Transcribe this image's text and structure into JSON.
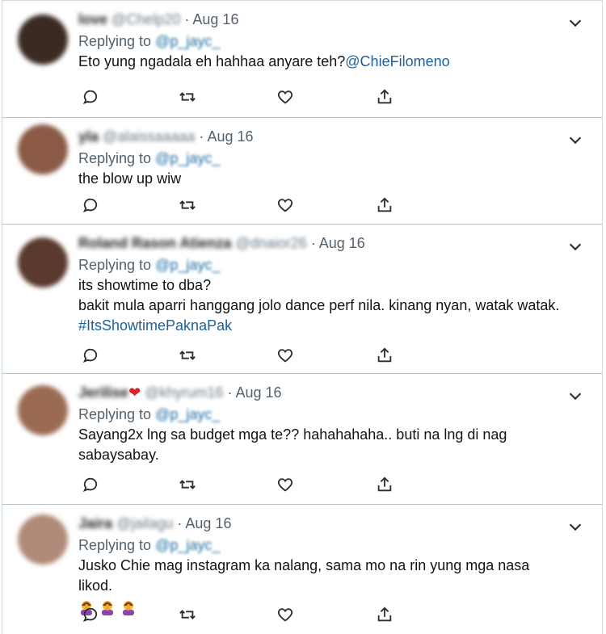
{
  "tweets": [
    {
      "name": "love",
      "handle": "@Chelp20",
      "date": "Aug 16",
      "replying_label": "Replying to",
      "replying_to": "@p_jayc_",
      "lines": [
        "Eto yung ngadala eh hahhaa anyare teh?"
      ],
      "trailing_link": "@ChieFilomeno",
      "avatar_color": "#3b2a22"
    },
    {
      "name": "yla",
      "handle": "@alaissaaaaa",
      "date": "Aug 16",
      "replying_label": "Replying to",
      "replying_to": "@p_jayc_",
      "lines": [
        "the blow up wiw"
      ],
      "avatar_color": "#8a5a46"
    },
    {
      "name": "Roland Rason Atienza",
      "handle": "@dnaior26",
      "date": "Aug 16",
      "replying_label": "Replying to",
      "replying_to": "@p_jayc_",
      "lines": [
        "its showtime to dba?",
        "bakit mula aparri hanggang jolo dance perf nila. kinang nyan, watak watak."
      ],
      "hashtag": "#ItsShowtimePaknaPak",
      "avatar_color": "#5a3a2e"
    },
    {
      "name": "Jerilise",
      "handle": "@khyrum16",
      "date": "Aug 16",
      "replying_label": "Replying to",
      "replying_to": "@p_jayc_",
      "lines": [
        "Sayang2x lng sa budget mga te?? hahahahaha.. buti na lng di nag",
        "sabaysabay."
      ],
      "avatar_color": "#9a6b52"
    },
    {
      "name": "Jaira",
      "handle": "@jailagu",
      "date": "Aug 16",
      "replying_label": "Replying to",
      "replying_to": "@p_jayc_",
      "lines": [
        "Jusko Chie mag instagram ka nalang, sama mo na rin yung mga nasa likod."
      ],
      "emoji_count": 3,
      "avatar_color": "#b08a78"
    }
  ],
  "icons": {
    "more": "chevron-down-icon",
    "reply": "reply-icon",
    "retweet": "retweet-icon",
    "like": "like-icon",
    "share": "share-icon",
    "emoji": "person-facepalming-emoji"
  },
  "colors": {
    "link": "#1d5f99",
    "muted": "#54616c",
    "border": "#cfd9de"
  }
}
